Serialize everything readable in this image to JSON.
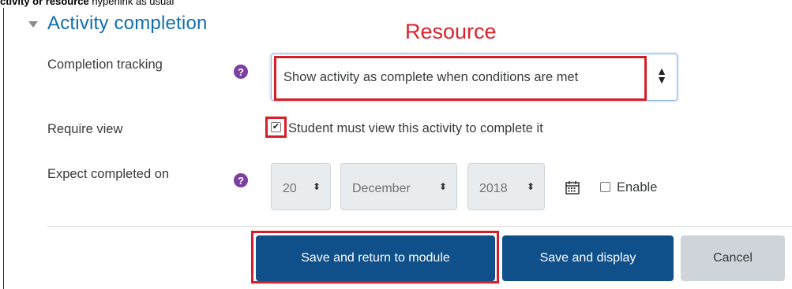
{
  "caption": {
    "bold": "ctivity or resource",
    "rest": " hyperlink as usual"
  },
  "section": {
    "title": "Activity completion"
  },
  "annotation": {
    "text": "Resource",
    "color": "#e0202a"
  },
  "fields": {
    "completion_tracking": {
      "label": "Completion tracking",
      "help_icon": "question-icon",
      "value": "Show activity as complete when conditions are met"
    },
    "require_view": {
      "label": "Require view",
      "checkbox_label": "Student must view this activity to complete it",
      "checked": true
    },
    "expect_completed": {
      "label": "Expect completed on",
      "help_icon": "question-icon",
      "day": "20",
      "month": "December",
      "year": "2018",
      "calendar_icon": "calendar-icon",
      "enable_label": "Enable",
      "enabled": false
    }
  },
  "buttons": {
    "save_return": "Save and return to module",
    "save_display": "Save and display",
    "cancel": "Cancel"
  },
  "colors": {
    "accent": "#0f6fae",
    "primary_button": "#0f4f8a",
    "highlight_box": "#d71e28",
    "help_icon": "#7b3fa0"
  }
}
